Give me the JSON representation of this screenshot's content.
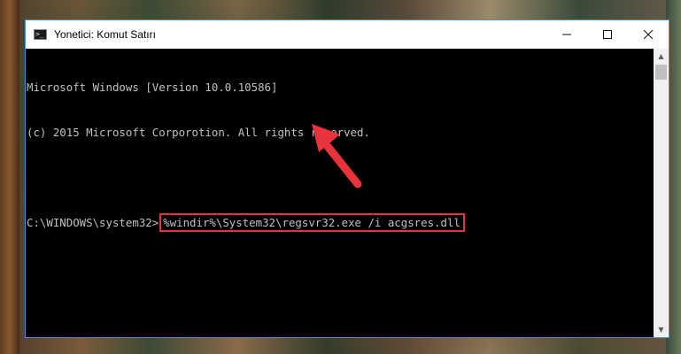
{
  "window": {
    "title": "Yonetici: Komut Satırı",
    "icon": "cmd-icon"
  },
  "controls": {
    "minimize": "—",
    "maximize": "☐",
    "close": "✕"
  },
  "console": {
    "line1": "Microsoft Windows [Version 10.0.10586]",
    "line2": "(c) 2015 Microsoft Corporotion. All rights reserved.",
    "prompt": "C:\\WINDOWS\\system32>",
    "command": "%windir%\\System32\\regsvr32.exe /i acgsres.dll"
  },
  "colors": {
    "highlight": "#e8323c",
    "console_bg": "#000000",
    "console_text": "#c0c0c0"
  }
}
